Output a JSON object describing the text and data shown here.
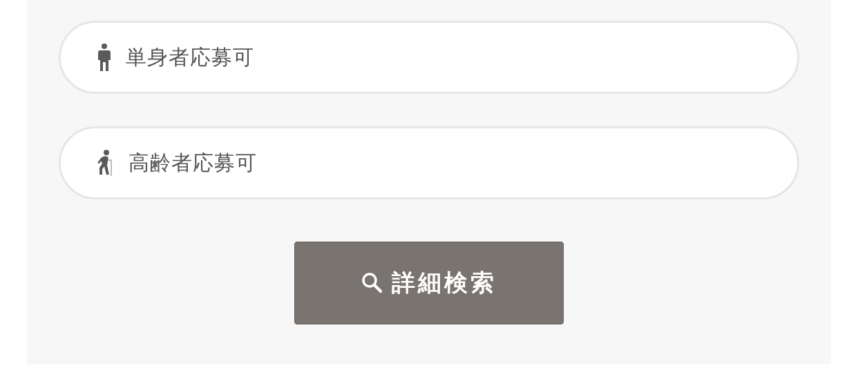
{
  "options": [
    {
      "kind": "single",
      "label": "単身者応募可"
    },
    {
      "kind": "elderly",
      "label": "高齢者応募可"
    }
  ],
  "search_button": {
    "label": "詳細検索"
  }
}
